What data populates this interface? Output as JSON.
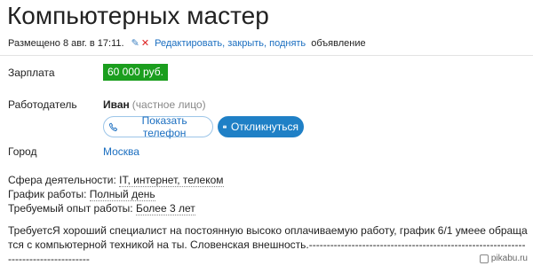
{
  "header": {
    "title": "Компьютерных мастер",
    "posted": "Размещено 8 авг. в 17:11.",
    "actions_link": "Редактировать, закрыть, поднять",
    "actions_tail": "объявление"
  },
  "salary": {
    "label": "Зарплата",
    "value": "60 000 руб."
  },
  "employer": {
    "label": "Работодатель",
    "name": "Иван",
    "type": "(частное лицо)",
    "phone_button": "Показать телефон",
    "respond_button": "Откликнуться"
  },
  "city": {
    "label": "Город",
    "value": "Москва"
  },
  "attributes": {
    "sphere_label": "Сфера деятельности:",
    "sphere_value": "IT, интернет, телеком",
    "schedule_label": "График работы:",
    "schedule_value": "Полный день",
    "experience_label": "Требуемый опыт работы:",
    "experience_value": "Более 3 лет"
  },
  "description": "ТребуетсЯ хороший специалист на постоянную высоко оплачиваемую работу, график 6/1 умеее обращатся с компьютерной техникой на ты. Словенская внешность.------------------------------------------------------------------------------------",
  "watermark": "pikabu.ru",
  "colors": {
    "salary_badge": "#1b9e1e",
    "link": "#1a6ec0",
    "respond_button": "#1f80c6"
  }
}
